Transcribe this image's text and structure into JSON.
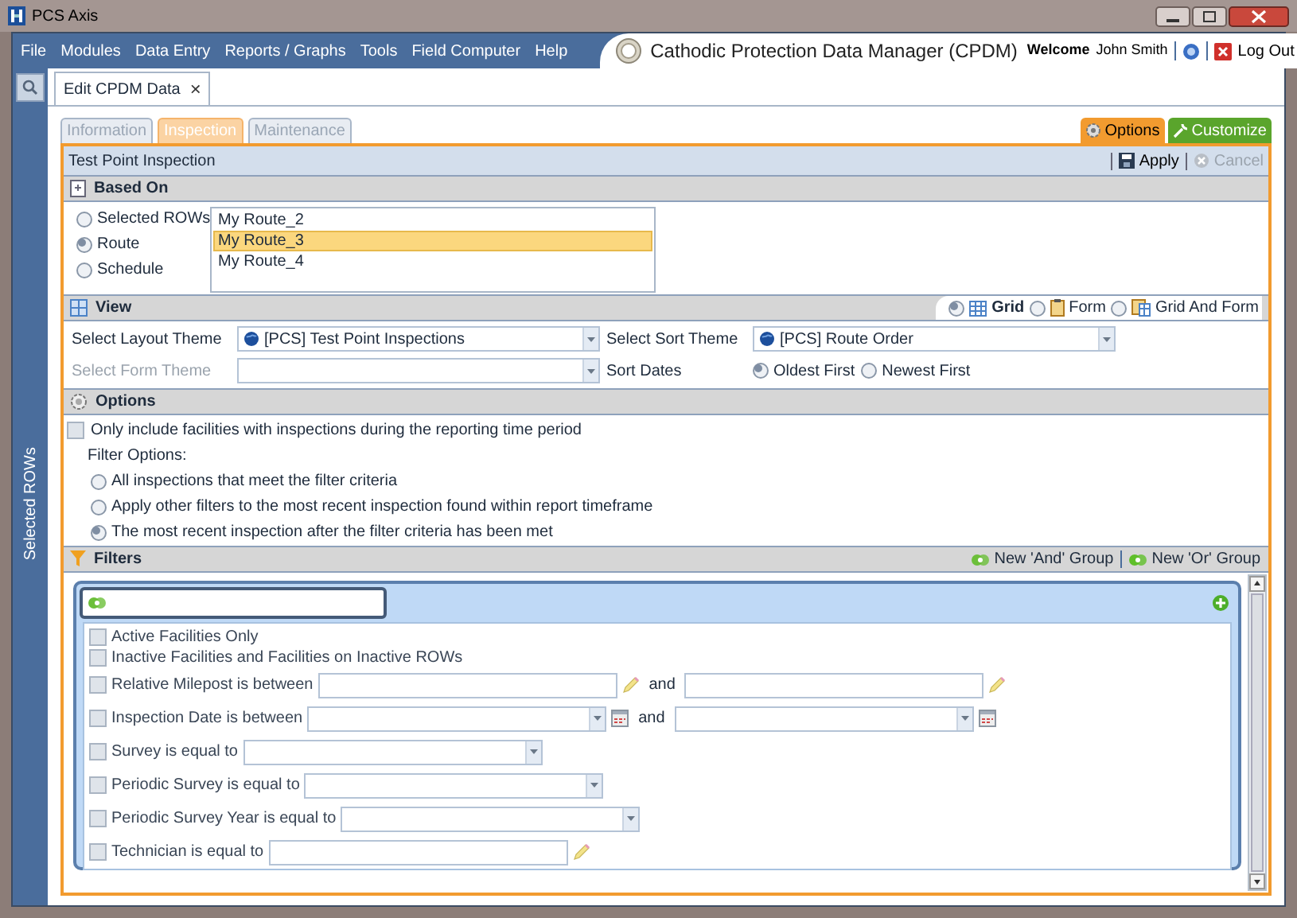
{
  "window": {
    "title": "PCS Axis"
  },
  "menu": [
    "File",
    "Modules",
    "Data Entry",
    "Reports / Graphs",
    "Tools",
    "Field Computer",
    "Help"
  ],
  "app_title": "Cathodic Protection Data Manager (CPDM)",
  "user": {
    "welcome": "Welcome",
    "name": "John Smith",
    "logout": "Log Out"
  },
  "document_tab": {
    "label": "Edit CPDM Data",
    "close": "×"
  },
  "sidebar": {
    "label": "Selected ROWs"
  },
  "tabs": [
    {
      "label": "Information",
      "selected": false
    },
    {
      "label": "Inspection",
      "selected": true
    },
    {
      "label": "Maintenance",
      "selected": false
    }
  ],
  "actions": [
    {
      "label": "Options",
      "kind": "options"
    },
    {
      "label": "Customize",
      "kind": "customize"
    }
  ],
  "panel": {
    "title": "Test Point Inspection",
    "apply": {
      "label": "Apply",
      "disabled": false
    },
    "cancel": {
      "label": "Cancel",
      "disabled": true
    }
  },
  "based_on": {
    "title": "Based On",
    "options": [
      {
        "label": "Selected ROWs",
        "selected": false
      },
      {
        "label": "Route",
        "selected": true
      },
      {
        "label": "Schedule",
        "selected": false
      }
    ],
    "routes": [
      {
        "label": "My Route_2",
        "selected": false
      },
      {
        "label": "My Route_3",
        "selected": true
      },
      {
        "label": "My Route_4",
        "selected": false
      }
    ]
  },
  "view": {
    "title": "View",
    "modes": [
      {
        "label": "Grid",
        "kind": "grid",
        "selected": true
      },
      {
        "label": "Form",
        "kind": "form",
        "selected": false
      },
      {
        "label": "Grid And Form",
        "kind": "gridform",
        "selected": false
      }
    ],
    "layout_theme": {
      "label": "Select Layout Theme",
      "value": "[PCS] Test Point Inspections"
    },
    "form_theme": {
      "label": "Select Form Theme",
      "disabled": true
    },
    "sort_theme": {
      "label": "Select Sort Theme",
      "value": "[PCS] Route Order"
    },
    "sort_dates": {
      "label": "Sort Dates",
      "options": [
        {
          "label": "Oldest First",
          "selected": true
        },
        {
          "label": "Newest First",
          "selected": false
        }
      ]
    }
  },
  "options": {
    "title": "Options",
    "only_include": {
      "label": "Only include facilities with inspections during the reporting time period",
      "checked": false
    },
    "filter_options_label": "Filter Options:",
    "filter_options": [
      {
        "label": "All inspections that meet the filter criteria",
        "selected": false
      },
      {
        "label": "Apply other filters to the most recent inspection found within report timeframe",
        "selected": false
      },
      {
        "label": "The most recent inspection after the filter criteria has been met",
        "selected": true
      }
    ]
  },
  "filters": {
    "title": "Filters",
    "new_and": "New 'And' Group",
    "new_or": "New 'Or' Group",
    "rows": [
      {
        "kind": "check",
        "label": "Active Facilities Only",
        "checked": false
      },
      {
        "kind": "check",
        "label": "Inactive Facilities and Facilities on Inactive ROWs",
        "checked": false
      },
      {
        "kind": "text_range",
        "label": "Relative Milepost is between",
        "and": "and",
        "checked": false
      },
      {
        "kind": "date_range",
        "label": "Inspection Date is between",
        "and": "and",
        "checked": false
      },
      {
        "kind": "combo",
        "label": "Survey is equal to",
        "checked": false
      },
      {
        "kind": "combo",
        "label": "Periodic Survey is equal to",
        "checked": false
      },
      {
        "kind": "combo",
        "label": "Periodic Survey Year is equal to",
        "checked": false
      },
      {
        "kind": "text",
        "label": "Technician is equal to",
        "checked": false
      }
    ]
  }
}
